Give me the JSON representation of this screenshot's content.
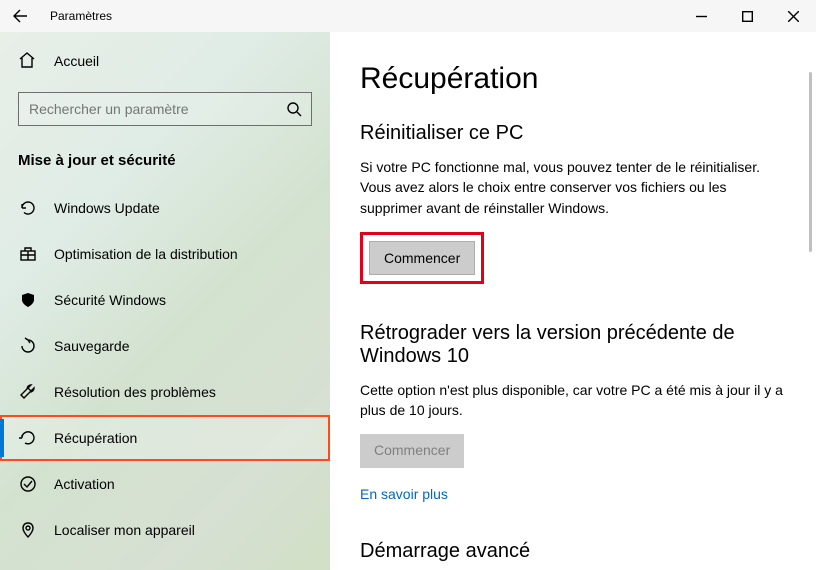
{
  "titlebar": {
    "title": "Paramètres"
  },
  "sidebar": {
    "home_label": "Accueil",
    "search_placeholder": "Rechercher un paramètre",
    "section_title": "Mise à jour et sécurité",
    "items": [
      {
        "label": "Windows Update"
      },
      {
        "label": "Optimisation de la distribution"
      },
      {
        "label": "Sécurité Windows"
      },
      {
        "label": "Sauvegarde"
      },
      {
        "label": "Résolution des problèmes"
      },
      {
        "label": "Récupération"
      },
      {
        "label": "Activation"
      },
      {
        "label": "Localiser mon appareil"
      }
    ]
  },
  "main": {
    "page_title": "Récupération",
    "reset": {
      "heading": "Réinitialiser ce PC",
      "desc": "Si votre PC fonctionne mal, vous pouvez tenter de le réinitialiser. Vous avez alors le choix entre conserver vos fichiers ou les supprimer avant de réinstaller Windows.",
      "button": "Commencer"
    },
    "rollback": {
      "heading": "Rétrograder vers la version précédente de Windows 10",
      "desc": "Cette option n'est plus disponible, car votre PC a été mis à jour il y a plus de 10 jours.",
      "button": "Commencer",
      "link": "En savoir plus"
    },
    "advanced": {
      "heading": "Démarrage avancé"
    }
  }
}
